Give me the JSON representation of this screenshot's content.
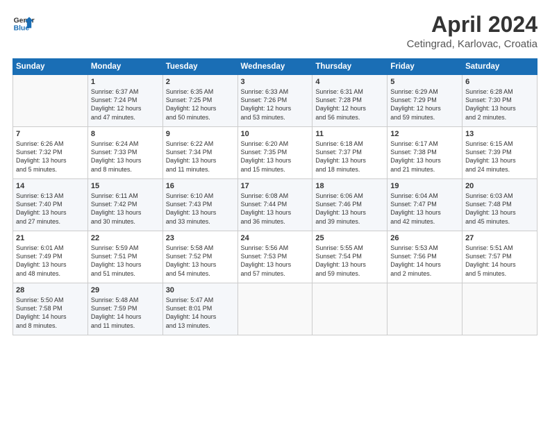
{
  "header": {
    "logo_line1": "General",
    "logo_line2": "Blue",
    "title": "April 2024",
    "subtitle": "Cetingrad, Karlovac, Croatia"
  },
  "columns": [
    "Sunday",
    "Monday",
    "Tuesday",
    "Wednesday",
    "Thursday",
    "Friday",
    "Saturday"
  ],
  "weeks": [
    [
      {
        "day": "",
        "text": ""
      },
      {
        "day": "1",
        "text": "Sunrise: 6:37 AM\nSunset: 7:24 PM\nDaylight: 12 hours\nand 47 minutes."
      },
      {
        "day": "2",
        "text": "Sunrise: 6:35 AM\nSunset: 7:25 PM\nDaylight: 12 hours\nand 50 minutes."
      },
      {
        "day": "3",
        "text": "Sunrise: 6:33 AM\nSunset: 7:26 PM\nDaylight: 12 hours\nand 53 minutes."
      },
      {
        "day": "4",
        "text": "Sunrise: 6:31 AM\nSunset: 7:28 PM\nDaylight: 12 hours\nand 56 minutes."
      },
      {
        "day": "5",
        "text": "Sunrise: 6:29 AM\nSunset: 7:29 PM\nDaylight: 12 hours\nand 59 minutes."
      },
      {
        "day": "6",
        "text": "Sunrise: 6:28 AM\nSunset: 7:30 PM\nDaylight: 13 hours\nand 2 minutes."
      }
    ],
    [
      {
        "day": "7",
        "text": "Sunrise: 6:26 AM\nSunset: 7:32 PM\nDaylight: 13 hours\nand 5 minutes."
      },
      {
        "day": "8",
        "text": "Sunrise: 6:24 AM\nSunset: 7:33 PM\nDaylight: 13 hours\nand 8 minutes."
      },
      {
        "day": "9",
        "text": "Sunrise: 6:22 AM\nSunset: 7:34 PM\nDaylight: 13 hours\nand 11 minutes."
      },
      {
        "day": "10",
        "text": "Sunrise: 6:20 AM\nSunset: 7:35 PM\nDaylight: 13 hours\nand 15 minutes."
      },
      {
        "day": "11",
        "text": "Sunrise: 6:18 AM\nSunset: 7:37 PM\nDaylight: 13 hours\nand 18 minutes."
      },
      {
        "day": "12",
        "text": "Sunrise: 6:17 AM\nSunset: 7:38 PM\nDaylight: 13 hours\nand 21 minutes."
      },
      {
        "day": "13",
        "text": "Sunrise: 6:15 AM\nSunset: 7:39 PM\nDaylight: 13 hours\nand 24 minutes."
      }
    ],
    [
      {
        "day": "14",
        "text": "Sunrise: 6:13 AM\nSunset: 7:40 PM\nDaylight: 13 hours\nand 27 minutes."
      },
      {
        "day": "15",
        "text": "Sunrise: 6:11 AM\nSunset: 7:42 PM\nDaylight: 13 hours\nand 30 minutes."
      },
      {
        "day": "16",
        "text": "Sunrise: 6:10 AM\nSunset: 7:43 PM\nDaylight: 13 hours\nand 33 minutes."
      },
      {
        "day": "17",
        "text": "Sunrise: 6:08 AM\nSunset: 7:44 PM\nDaylight: 13 hours\nand 36 minutes."
      },
      {
        "day": "18",
        "text": "Sunrise: 6:06 AM\nSunset: 7:46 PM\nDaylight: 13 hours\nand 39 minutes."
      },
      {
        "day": "19",
        "text": "Sunrise: 6:04 AM\nSunset: 7:47 PM\nDaylight: 13 hours\nand 42 minutes."
      },
      {
        "day": "20",
        "text": "Sunrise: 6:03 AM\nSunset: 7:48 PM\nDaylight: 13 hours\nand 45 minutes."
      }
    ],
    [
      {
        "day": "21",
        "text": "Sunrise: 6:01 AM\nSunset: 7:49 PM\nDaylight: 13 hours\nand 48 minutes."
      },
      {
        "day": "22",
        "text": "Sunrise: 5:59 AM\nSunset: 7:51 PM\nDaylight: 13 hours\nand 51 minutes."
      },
      {
        "day": "23",
        "text": "Sunrise: 5:58 AM\nSunset: 7:52 PM\nDaylight: 13 hours\nand 54 minutes."
      },
      {
        "day": "24",
        "text": "Sunrise: 5:56 AM\nSunset: 7:53 PM\nDaylight: 13 hours\nand 57 minutes."
      },
      {
        "day": "25",
        "text": "Sunrise: 5:55 AM\nSunset: 7:54 PM\nDaylight: 13 hours\nand 59 minutes."
      },
      {
        "day": "26",
        "text": "Sunrise: 5:53 AM\nSunset: 7:56 PM\nDaylight: 14 hours\nand 2 minutes."
      },
      {
        "day": "27",
        "text": "Sunrise: 5:51 AM\nSunset: 7:57 PM\nDaylight: 14 hours\nand 5 minutes."
      }
    ],
    [
      {
        "day": "28",
        "text": "Sunrise: 5:50 AM\nSunset: 7:58 PM\nDaylight: 14 hours\nand 8 minutes."
      },
      {
        "day": "29",
        "text": "Sunrise: 5:48 AM\nSunset: 7:59 PM\nDaylight: 14 hours\nand 11 minutes."
      },
      {
        "day": "30",
        "text": "Sunrise: 5:47 AM\nSunset: 8:01 PM\nDaylight: 14 hours\nand 13 minutes."
      },
      {
        "day": "",
        "text": ""
      },
      {
        "day": "",
        "text": ""
      },
      {
        "day": "",
        "text": ""
      },
      {
        "day": "",
        "text": ""
      }
    ]
  ]
}
